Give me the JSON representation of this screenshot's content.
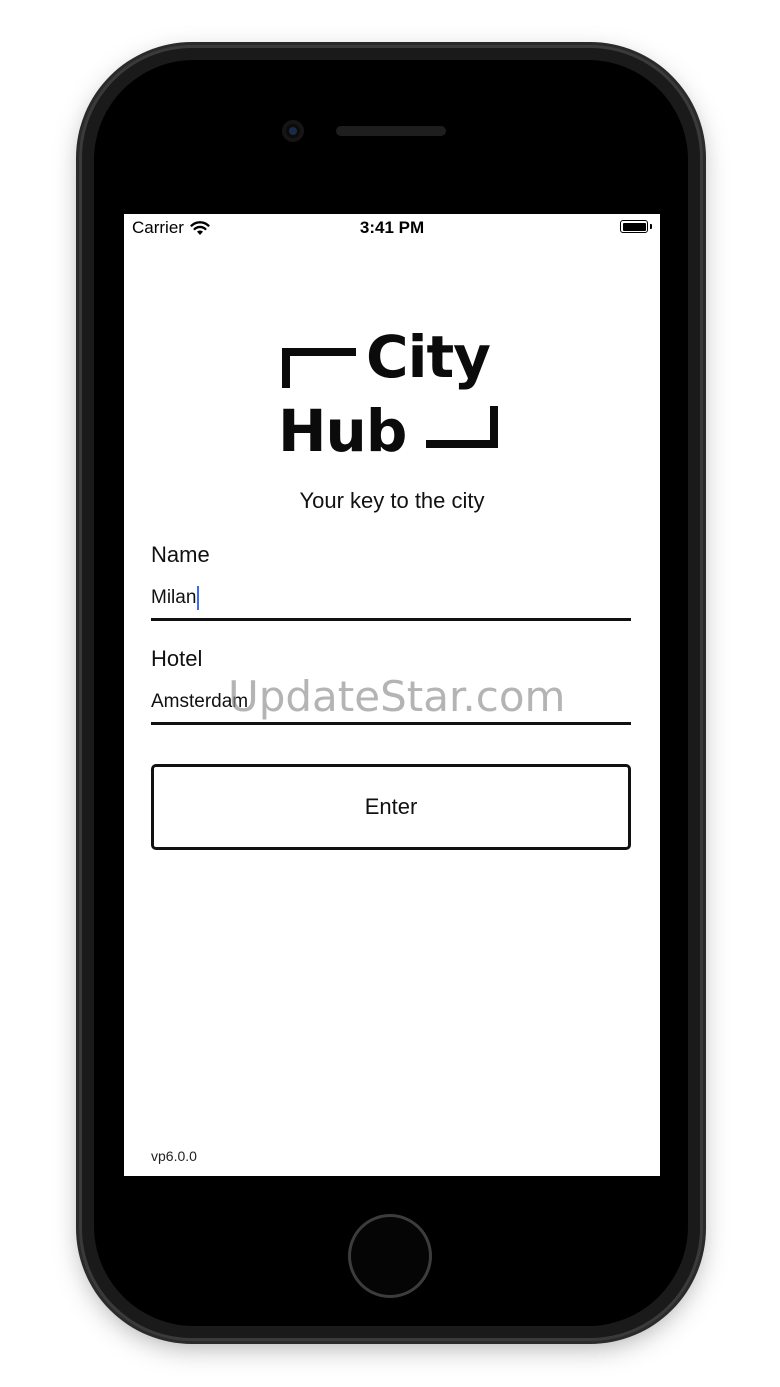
{
  "status_bar": {
    "carrier": "Carrier",
    "time": "3:41 PM",
    "icons": [
      "wifi-icon",
      "battery-icon"
    ]
  },
  "logo": {
    "line1": "City",
    "line2": "Hub"
  },
  "tagline": "Your key to the city",
  "form": {
    "name_label": "Name",
    "name_value": "Milan",
    "hotel_label": "Hotel",
    "hotel_value": "Amsterdam",
    "enter_label": "Enter"
  },
  "version": "vp6.0.0",
  "watermark": "UpdateStar.com",
  "colors": {
    "caret": "#3b6cf0",
    "text": "#111111",
    "background": "#ffffff"
  }
}
